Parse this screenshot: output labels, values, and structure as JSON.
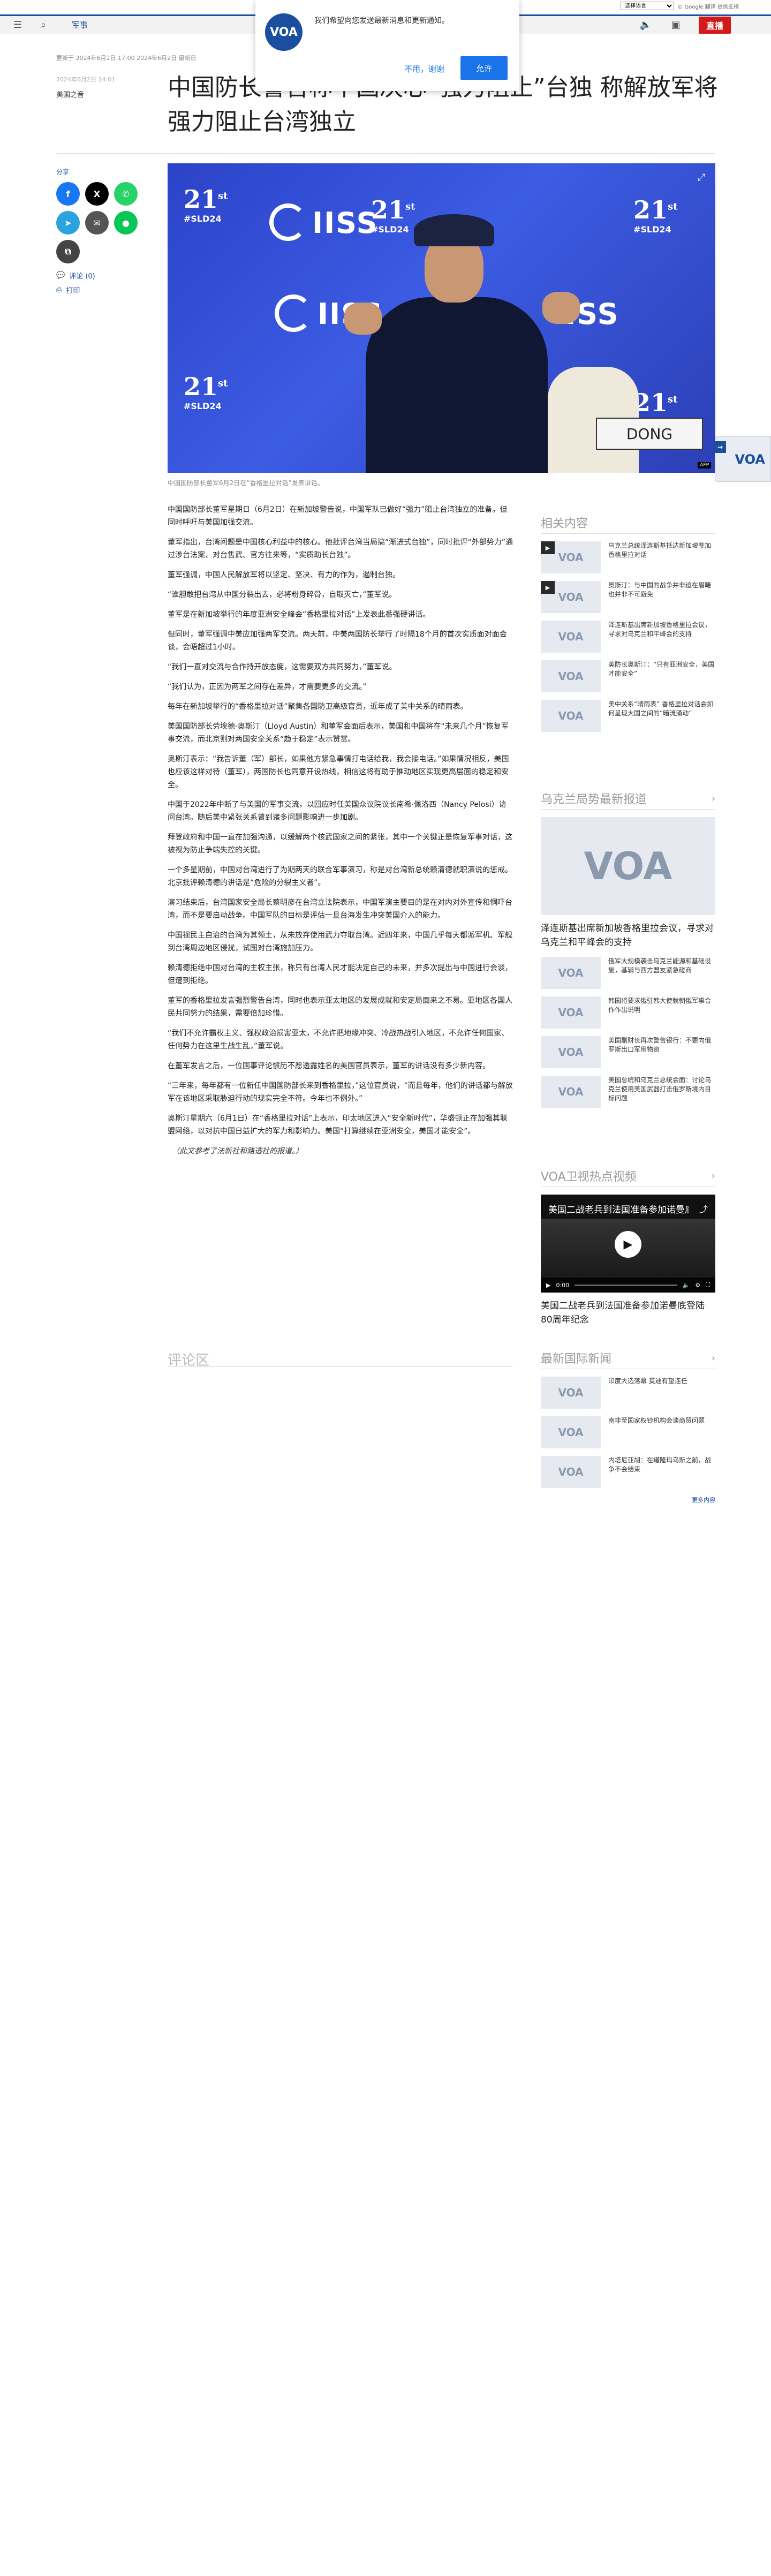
{
  "translate": {
    "select_label": "选择语言",
    "powered": "© Google 翻译 提供支持"
  },
  "nav": {
    "section": "军事",
    "live": "直播"
  },
  "notification": {
    "logo": "VOA",
    "text": "我们希望向您发送最新消息和更新通知。",
    "decline": "不用，谢谢",
    "accept": "允许"
  },
  "article": {
    "dateline": "更新于 2024年6月2日 17:00 2024年6月2日 最新日",
    "date": "2024年6月2日 14:01",
    "author": "美国之音",
    "headline": "中国防长警告称中国决心“强力阻止”台独 称解放军将强力阻止台湾独立",
    "hero_caption": "中国国防部长董军6月2日在“香格里拉对话”发表讲话。",
    "paragraphs": [
      "中国国防部长董军星期日（6月2日）在新加坡警告说，中国军队已做好“强力”阻止台湾独立的准备。但同时呼吁与美国加强交流。",
      "董军指出，台湾问题是中国核心利益中的核心。他批评台湾当局搞“渐进式台独”，同时批评“外部势力”通过涉台法案、对台售武、官方往来等，“实质助长台独”。",
      "董军强调，中国人民解放军将以坚定、坚决、有力的作为，遏制台独。",
      "“谁胆敢把台湾从中国分裂出去，必将粉身碎骨，自取灭亡，”董军说。",
      "董军是在新加坡举行的年度亚洲安全峰会“香格里拉对话”上发表此番强硬讲话。",
      "但同时，董军强调中美应加强两军交流。两天前，中美两国防长举行了时隔18个月的首次实质面对面会谈，会晤超过1小时。",
      "“我们一直对交流与合作持开放态度，这需要双方共同努力，”董军说。",
      "“我们认为，正因为两军之间存在差异，才需要更多的交流。”",
      "每年在新加坡举行的“香格里拉对话”聚集各国防卫高级官员，近年成了美中关系的晴雨表。",
      "美国国防部长劳埃德·奥斯汀（Lloyd Austin）和董军会面后表示，美国和中国将在“未来几个月”恢复军事交流，而北京则对两国安全关系“趋于稳定”表示赞赏。",
      "奥斯汀表示：“我告诉董（军）部长，如果他方紧急事情打电话给我，我会接电话。”如果情况相反，美国也应该这样对待（董军），两国防长也同意开设热线，相信这将有助于推动地区实现更高层面的稳定和安全。",
      "中国于2022年中断了与美国的军事交流，以回应时任美国众议院议长南希·佩洛西（Nancy Pelosi）访问台湾。随后美中紧张关系曾到诸多问题影响进一步加剧。",
      "拜登政府和中国一直在加强沟通，以缓解两个核武国家之间的紧张，其中一个关键正是恢复军事对话，这被视为防止争端失控的关键。",
      "一个多星期前，中国对台湾进行了为期两天的联合军事演习，称是对台湾新总统赖清德就职演说的惩戒。北京批评赖清德的讲话是“危险的分裂主义者”。",
      "演习结束后，台湾国家安全局长蔡明彦在台湾立法院表示，中国军演主要目的是在对内对外宣传和恫吓台湾，而不是要启动战争。中国军队的目标是评估一旦台海发生冲突美国介入的能力。",
      "中国视民主自治的台湾为其领土，从未放弃使用武力夺取台湾。近四年来，中国几乎每天都派军机、军舰到台湾周边地区侵扰，试图对台湾施加压力。",
      "赖清德拒绝中国对台湾的主权主张，称只有台湾人民才能决定自己的未来，并多次提出与中国进行会谈，但遭到拒绝。",
      "董军的香格里拉发言强烈警告台湾，同时也表示亚太地区的发展成就和安定局面来之不易。亚地区各国人民共同努力的结果，需要倍加珍惜。",
      "“我们不允许霸权主义、强权政治损害亚太，不允许把地缘冲突、冷战热战引入地区，不允许任何国家、任何势力在这里生战生乱，”董军说。",
      "在董军发言之后，一位国事评论惯历不愿透露姓名的美国官员表示，董军的讲话没有多少新内容。",
      "“三年来，每年都有一位新任中国国防部长来到香格里拉，”这位官员说，“而且每年，他们的讲话都与解放军在该地区采取胁迫行动的现实完全不符。今年也不例外。”",
      "奥斯汀星期六（6月1日）在“香格里拉对话”上表示，印太地区进入“安全新时代”，华盛顿正在加强其联盟网络，以对抗中国日益扩大的军力和影响力。美国“打算继续在亚洲安全，美国才能安全”。",
      "（此文参考了法新社和路透社的报道。）"
    ],
    "comments_title": "评论区"
  },
  "share": {
    "label": "分享",
    "buttons": [
      {
        "icon": "facebook-icon",
        "glyph": "f",
        "color": "#1877f2"
      },
      {
        "icon": "x-twitter-icon",
        "glyph": "X",
        "color": "#000000"
      },
      {
        "icon": "whatsapp-icon",
        "glyph": "✆",
        "color": "#25d366"
      },
      {
        "icon": "telegram-icon",
        "glyph": "➤",
        "color": "#2aa3df"
      },
      {
        "icon": "email-icon",
        "glyph": "✉",
        "color": "#555555"
      },
      {
        "icon": "line-icon",
        "glyph": "●",
        "color": "#06c755"
      },
      {
        "icon": "copy-link-icon",
        "glyph": "⧉",
        "color": "#444444"
      }
    ],
    "comments_link": "评论 (0)",
    "print_link": "打印"
  },
  "related": {
    "title": "相关内容",
    "items": [
      {
        "text": "乌克兰总统泽连斯基抵达新加坡参加香格里拉对话",
        "video": true
      },
      {
        "text": "奥斯汀：与中国的战争并非迫在眉睫也并非不可避免",
        "video": true
      },
      {
        "text": "泽连斯基出席新加坡香格里拉会议，寻求对乌克兰和平峰会的支持",
        "video": false
      },
      {
        "text": "美防长奥斯汀：“只有亚洲安全，美国才能安全”",
        "video": false
      },
      {
        "text": "美中关系“晴雨表” 香格里拉对话会如何呈现大国之间的“暗流涌动”",
        "video": false
      }
    ]
  },
  "ukraine": {
    "title": "乌克兰局势最新报道",
    "lead_caption": "泽连斯基出席新加坡香格里拉会议，寻求对乌克兰和平峰会的支持",
    "items": [
      {
        "text": "俄军大规模袭击乌克兰能源和基础设施，基辅与西方盟友紧急磋商"
      },
      {
        "text": "韩国将要求俄驻韩大使就朝俄军事合作作出说明"
      },
      {
        "text": "美国副财长再次警告银行：不要向俄罗斯出口军用物资"
      },
      {
        "text": "美国总统和乌克兰总统会面：讨论乌克兰使用美国武器打击俄罗斯境内目标问题"
      }
    ]
  },
  "video_section": {
    "title": "VOA卫视热点视频",
    "video_title": "美国二战老兵到法国准备参加诺曼底登陆80周年纪念",
    "time": "0:00",
    "caption": "美国二战老兵到法国准备参加诺曼底登陆80周年纪念"
  },
  "intl": {
    "title": "最新国际新闻",
    "items": [
      {
        "text": "印度大选落幕 莫迪有望连任"
      },
      {
        "text": "南非至国家权钞机构会谈商贸问题"
      },
      {
        "text": "内塔尼亚胡：在罐隆玛乌斯之前，战争不会结束"
      }
    ],
    "more": "更多内容"
  },
  "floating": {
    "logo": "VOA"
  },
  "colors": {
    "brand": "#1a4e9e",
    "live": "#d21a1a",
    "link": "#1a73e8"
  }
}
